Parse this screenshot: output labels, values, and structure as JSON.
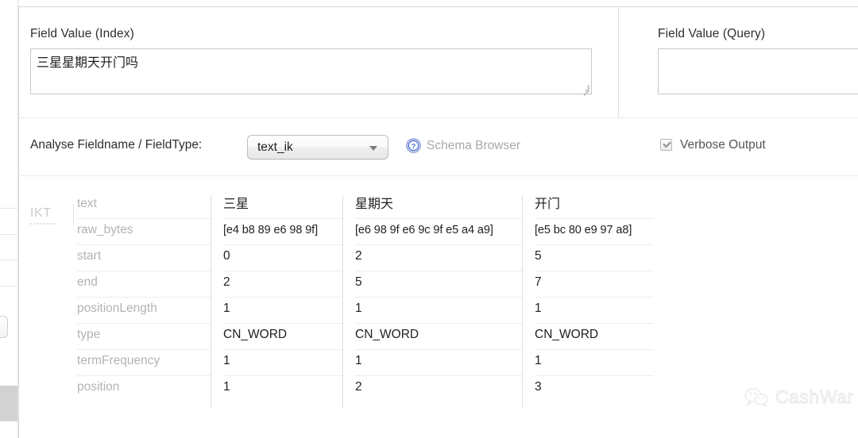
{
  "index_field": {
    "label": "Field Value (Index)",
    "value": "三星星期天开门吗",
    "resize_grip_icon": "resize-grip-icon"
  },
  "query_field": {
    "label": "Field Value (Query)",
    "value": ""
  },
  "options": {
    "analyse_label": "Analyse Fieldname / FieldType:",
    "fieldtype_selected": "text_ik",
    "fieldtype_caret_icon": "chevron-down-icon",
    "help_icon": "question-mark-circle-icon",
    "schema_browser_label": "Schema Browser",
    "verbose_label": "Verbose Output",
    "verbose_checked": true,
    "check_icon": "checkmark-icon"
  },
  "analysis": {
    "analyzer_tag": "IKT",
    "row_labels": [
      "text",
      "raw_bytes",
      "start",
      "end",
      "positionLength",
      "type",
      "termFrequency",
      "position"
    ],
    "tokens": [
      {
        "text": "三星",
        "raw_bytes": "[e4 b8 89 e6 98 9f]",
        "start": "0",
        "end": "2",
        "positionLength": "1",
        "type": "CN_WORD",
        "termFrequency": "1",
        "position": "1"
      },
      {
        "text": "星期天",
        "raw_bytes": "[e6 98 9f e6 9c 9f e5 a4 a9]",
        "start": "2",
        "end": "5",
        "positionLength": "1",
        "type": "CN_WORD",
        "termFrequency": "1",
        "position": "2"
      },
      {
        "text": "开门",
        "raw_bytes": "[e5 bc 80 e9 97 a8]",
        "start": "5",
        "end": "7",
        "positionLength": "1",
        "type": "CN_WORD",
        "termFrequency": "1",
        "position": "3"
      }
    ]
  },
  "watermark": {
    "text": "CashWar",
    "icon": "wechat-logo-icon"
  },
  "colors": {
    "accent_blue": "#4a6fd4",
    "label_gray": "#b3b3b3",
    "text_dark": "#1f1f1f",
    "border": "#d8d8d8"
  }
}
